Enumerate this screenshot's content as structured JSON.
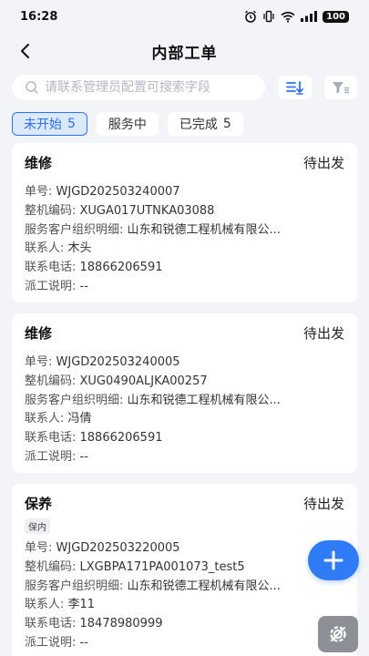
{
  "status_bar": {
    "time": "16:28",
    "battery": "100",
    "icons": [
      "alarm-icon",
      "vibrate-icon",
      "wifi-icon",
      "signal-icon"
    ]
  },
  "header": {
    "title": "内部工单",
    "back_icon": "chevron-left-icon"
  },
  "search": {
    "placeholder": "请联系管理员配置可搜索字段",
    "value": ""
  },
  "tabs": [
    {
      "label": "未开始",
      "count": "5",
      "active": true
    },
    {
      "label": "服务中",
      "count": "",
      "active": false
    },
    {
      "label": "已完成",
      "count": "5",
      "active": false
    }
  ],
  "field_labels": {
    "order_no": "单号: ",
    "machine_code": "整机编码: ",
    "customer_org": "服务客户组织明细: ",
    "contact": "联系人: ",
    "phone": "联系电话: ",
    "dispatch_note": "派工说明: "
  },
  "orders": [
    {
      "type": "维修",
      "status": "待出发",
      "tag": "",
      "order_no": "WJGD202503240007",
      "machine_code": "XUGA017UTNKA03088",
      "customer_org": "山东和锐德工程机械有限公...",
      "contact": "木头",
      "phone": "18866206591",
      "dispatch_note": "--"
    },
    {
      "type": "维修",
      "status": "待出发",
      "tag": "",
      "order_no": "WJGD202503240005",
      "machine_code": "XUG0490ALJKA00257",
      "customer_org": "山东和锐德工程机械有限公...",
      "contact": "冯倩",
      "phone": "18866206591",
      "dispatch_note": "--"
    },
    {
      "type": "保养",
      "status": "待出发",
      "tag": "保内",
      "order_no": "WJGD202503220005",
      "machine_code": "LXGBPA171PA001073_test5",
      "customer_org": "山东和锐德工程机械有限公...",
      "contact": "李11",
      "phone": "18478980999",
      "dispatch_note": "--"
    }
  ],
  "colors": {
    "accent": "#2d6ff0",
    "fab": "#2f7cf6",
    "background": "#f2f4f7"
  }
}
